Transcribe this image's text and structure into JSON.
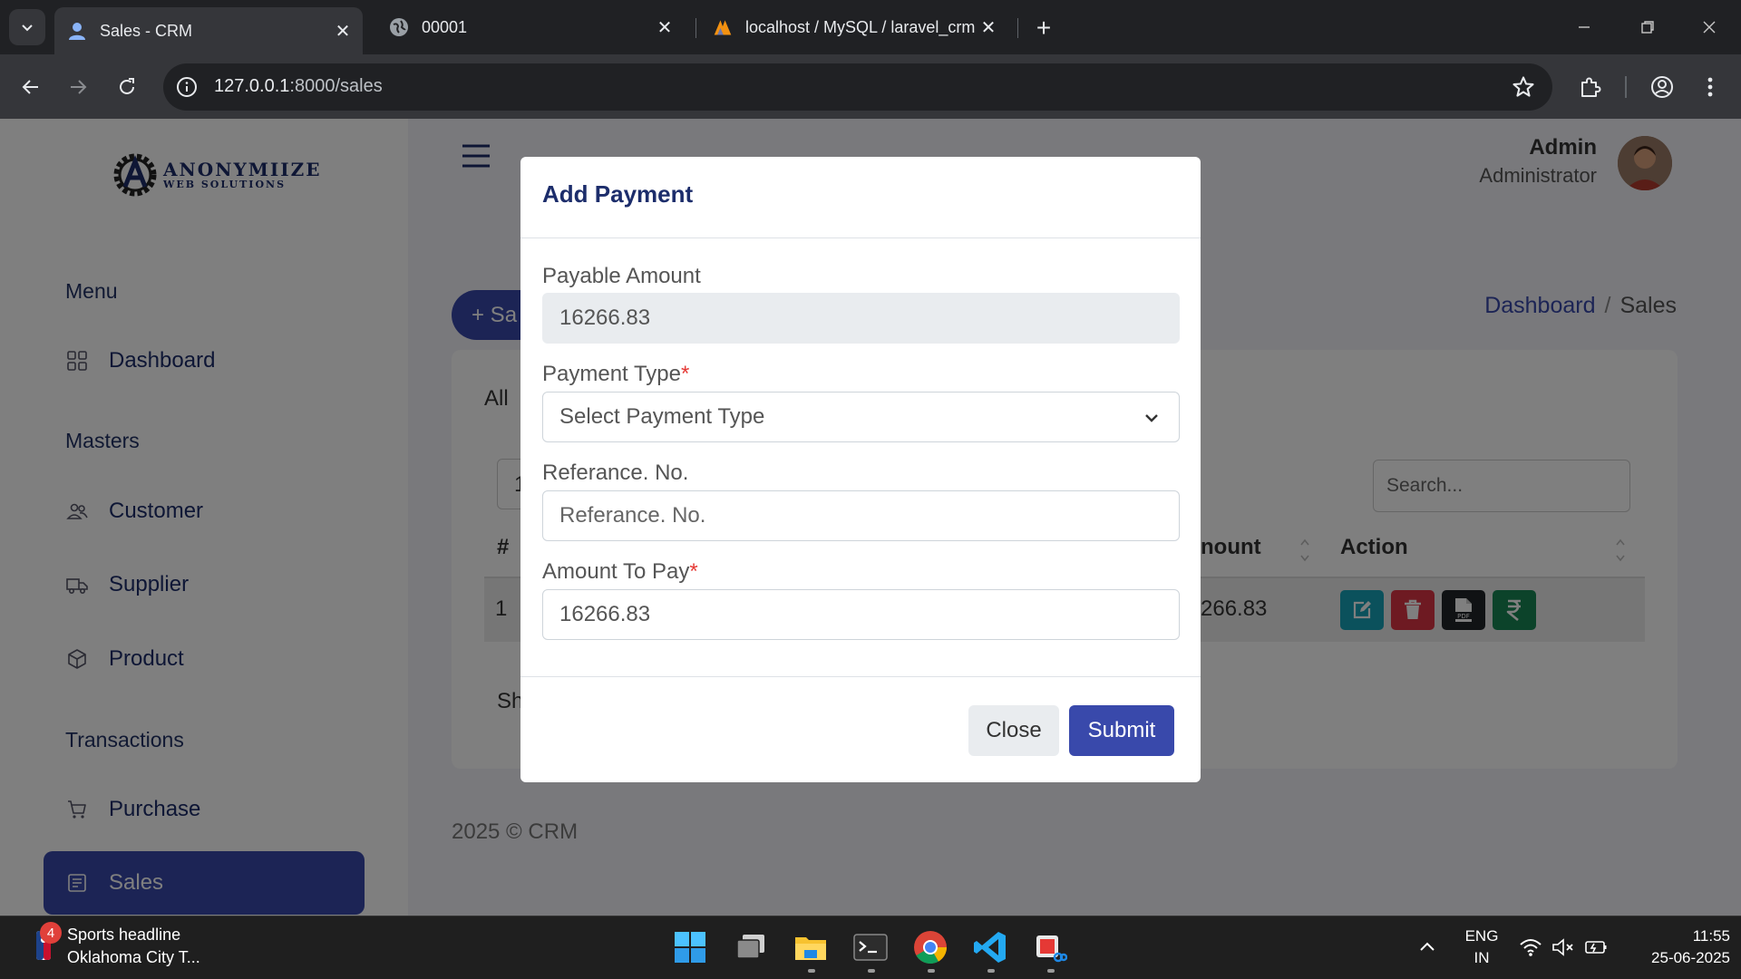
{
  "browser": {
    "tabs": [
      {
        "title": "Sales - CRM",
        "active": true
      },
      {
        "title": "00001",
        "active": false
      },
      {
        "title": "localhost / MySQL / laravel_crm",
        "active": false
      }
    ],
    "url_host": "127.0.0.1",
    "url_path": ":8000/sales"
  },
  "sidebar": {
    "logo_name": "ANONYMIIZE",
    "logo_sub": "WEB SOLUTIONS",
    "sections": {
      "menu": "Menu",
      "masters": "Masters",
      "transactions": "Transactions"
    },
    "items": {
      "dashboard": "Dashboard",
      "customer": "Customer",
      "supplier": "Supplier",
      "product": "Product",
      "purchase": "Purchase",
      "sales": "Sales"
    },
    "active_item": "Sales"
  },
  "header": {
    "user_name": "Admin",
    "user_role": "Administrator"
  },
  "page": {
    "add_button": "+ Sa",
    "breadcrumb": [
      "Dashboard",
      "Sales"
    ],
    "card_title": "All",
    "entries_value": "1",
    "search_placeholder": "Search...",
    "columns": {
      "hash": "#",
      "amount_partial": "nount",
      "action": "Action"
    },
    "rows": [
      {
        "index": "1",
        "amount_partial": "266.83"
      }
    ],
    "showing_partial": "Sh",
    "footer": "2025 © CRM"
  },
  "modal": {
    "title": "Add Payment",
    "payable_label": "Payable Amount",
    "payable_value": "16266.83",
    "payment_type_label": "Payment Type",
    "payment_type_value": "Select Payment Type",
    "reference_label": "Referance. No.",
    "reference_placeholder": "Referance. No.",
    "amount_label": "Amount To Pay",
    "amount_value": "16266.83",
    "required_mark": "*",
    "close_label": "Close",
    "submit_label": "Submit"
  },
  "taskbar": {
    "news_badge": "4",
    "news_title": "Sports headline",
    "news_sub": "Oklahoma City T...",
    "lang_top": "ENG",
    "lang_bottom": "IN",
    "time": "11:55",
    "date": "25-06-2025"
  },
  "colors": {
    "primary": "#3949ab",
    "edit": "#17a2b8",
    "delete": "#dc3545",
    "pdf": "#212529",
    "pay": "#198754"
  }
}
